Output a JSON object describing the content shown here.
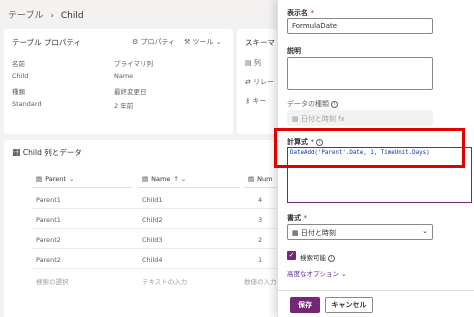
{
  "breadcrumb": {
    "parent": "テーブル",
    "separator": "›",
    "current": "Child"
  },
  "props": {
    "title": "テーブル プロパティ",
    "btn_props": "プロパティ",
    "btn_tools": "ツール",
    "rows": [
      {
        "label": "名前",
        "value": "プライマリ列"
      },
      {
        "label": "Child",
        "value": "Name"
      },
      {
        "label": "種類",
        "value": "最終変更日"
      },
      {
        "label": "Standard",
        "value": "2 年前"
      }
    ]
  },
  "schema": {
    "title": "スキーマ",
    "item1": "列",
    "item2": "リレー",
    "item3": "キー"
  },
  "grid": {
    "title": "Child 列とデータ",
    "columns": [
      {
        "label": "Parent",
        "sort": "⌄"
      },
      {
        "label": "Name",
        "sort": "↑ ⌄"
      },
      {
        "label": "Num",
        "sort": "⌄"
      }
    ],
    "rows": [
      [
        "Parent1",
        "Child1",
        "4"
      ],
      [
        "Parent1",
        "Child2",
        "3"
      ],
      [
        "Parent2",
        "Child3",
        "2"
      ],
      [
        "Parent2",
        "Child4",
        "1"
      ]
    ],
    "footer": [
      "検索の選択",
      "テキストの入力",
      "数値の入力"
    ]
  },
  "panel": {
    "display_name_label": "表示名",
    "display_name_value": "FormulaDate",
    "description_label": "説明",
    "datatype_label": "データの種類",
    "datatype_value": "日付と時刻 fx",
    "formula_label": "計算式",
    "formula_value": "DateAdd('Parent'.Date, 1, TimeUnit.Days)",
    "format_label": "書式",
    "format_value": "日付と時刻",
    "searchable_label": "検索可能",
    "advanced_label": "高度なオプション",
    "save_label": "保存",
    "cancel_label": "キャンセル",
    "required_mark": "*"
  },
  "colors": {
    "accent": "#742774",
    "highlight": "#e00000",
    "link": "#5c2d91"
  }
}
